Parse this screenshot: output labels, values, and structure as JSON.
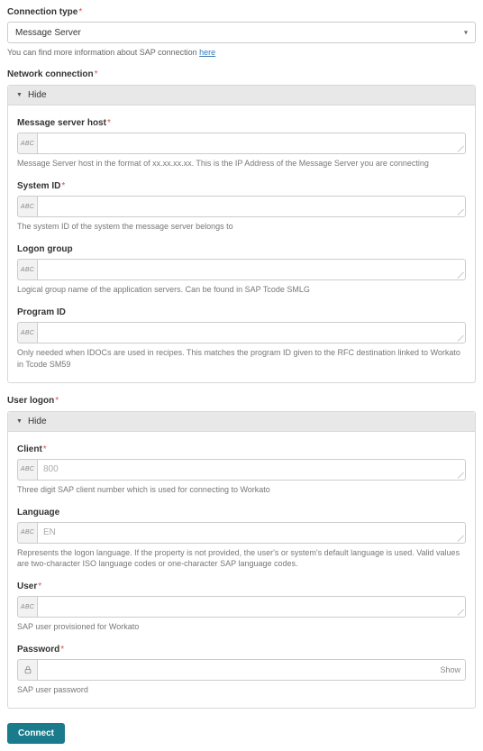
{
  "connectionType": {
    "label": "Connection type",
    "value": "Message Server",
    "info_prefix": "You can find more information about SAP connection ",
    "info_link": "here"
  },
  "network": {
    "label": "Network connection",
    "toggle": "Hide",
    "fields": {
      "messageHost": {
        "label": "Message server host",
        "value": "",
        "help": "Message Server host in the format of xx.xx.xx.xx. This is the IP Address of the Message Server you are connecting"
      },
      "systemId": {
        "label": "System ID",
        "value": "",
        "help": "The system ID of the system the message server belongs to"
      },
      "logonGroup": {
        "label": "Logon group",
        "value": "",
        "help": "Logical group name of the application servers. Can be found in SAP Tcode SMLG"
      },
      "programId": {
        "label": "Program ID",
        "value": "",
        "help": "Only needed when IDOCs are used in recipes. This matches the program ID given to the RFC destination linked to Workato in Tcode SM59"
      }
    }
  },
  "userLogon": {
    "label": "User logon",
    "toggle": "Hide",
    "fields": {
      "client": {
        "label": "Client",
        "placeholder": "800",
        "value": "",
        "help": "Three digit SAP client number which is used for connecting to Workato"
      },
      "language": {
        "label": "Language",
        "placeholder": "EN",
        "value": "",
        "help": "Represents the logon language. If the property is not provided, the user's or system's default language is used. Valid values are two-character ISO language codes or one-character SAP language codes."
      },
      "user": {
        "label": "User",
        "value": "",
        "help": "SAP user provisioned for Workato"
      },
      "password": {
        "label": "Password",
        "value": "",
        "show": "Show",
        "help": "SAP user password"
      }
    }
  },
  "prefix": "ABC",
  "connect": "Connect"
}
